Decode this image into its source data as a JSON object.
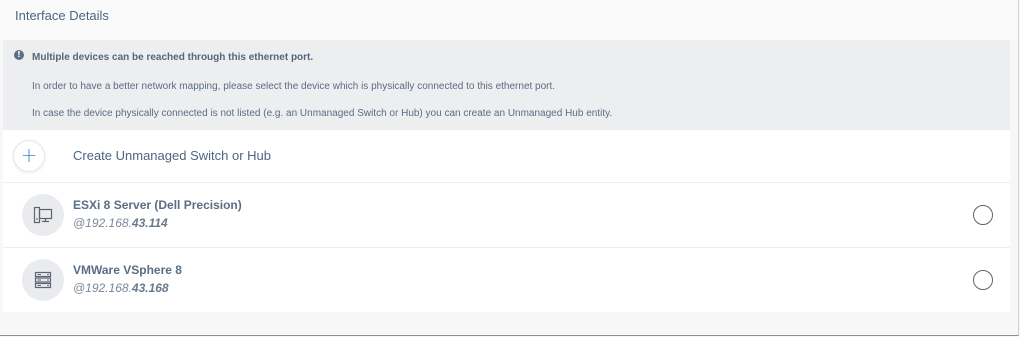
{
  "header": {
    "title": "Interface Details"
  },
  "notice": {
    "title": "Multiple devices can be reached through this ethernet port.",
    "line1": "In order to have a better network mapping, please select the device which is physically connected to this ethernet port.",
    "line2": "In case the device physically connected is not listed (e.g. an Unmanaged Switch or Hub) you can create an Unmanaged Hub entity.",
    "icon": "info-icon"
  },
  "create": {
    "label": "Create Unmanaged Switch or Hub",
    "icon": "plus-icon",
    "accent": "#4a90e2"
  },
  "devices": [
    {
      "name": "ESXi 8 Server (Dell Precision)",
      "ip_prefix": "@192.168.",
      "ip_suffix": "43.114",
      "icon": "workstation-icon",
      "selected": false
    },
    {
      "name": "VMWare VSphere 8",
      "ip_prefix": "@192.168.",
      "ip_suffix": "43.168",
      "icon": "server-rack-icon",
      "selected": false
    }
  ]
}
